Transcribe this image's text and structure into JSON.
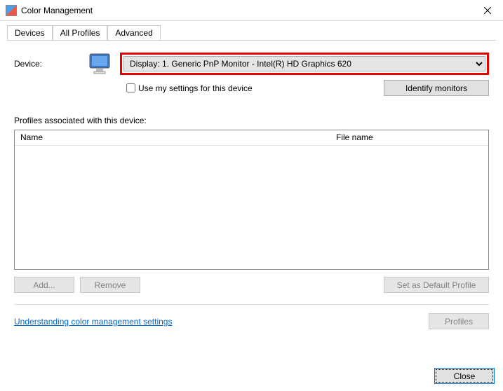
{
  "window": {
    "title": "Color Management"
  },
  "tabs": {
    "devices": "Devices",
    "all_profiles": "All Profiles",
    "advanced": "Advanced"
  },
  "device": {
    "label": "Device:",
    "selected": "Display: 1. Generic PnP Monitor - Intel(R) HD Graphics 620",
    "use_my_settings": "Use my settings for this device",
    "identify": "Identify monitors"
  },
  "profiles": {
    "section": "Profiles associated with this device:",
    "col_name": "Name",
    "col_file": "File name"
  },
  "buttons": {
    "add": "Add...",
    "remove": "Remove",
    "set_default": "Set as Default Profile",
    "profiles": "Profiles",
    "close": "Close"
  },
  "link": "Understanding color management settings"
}
